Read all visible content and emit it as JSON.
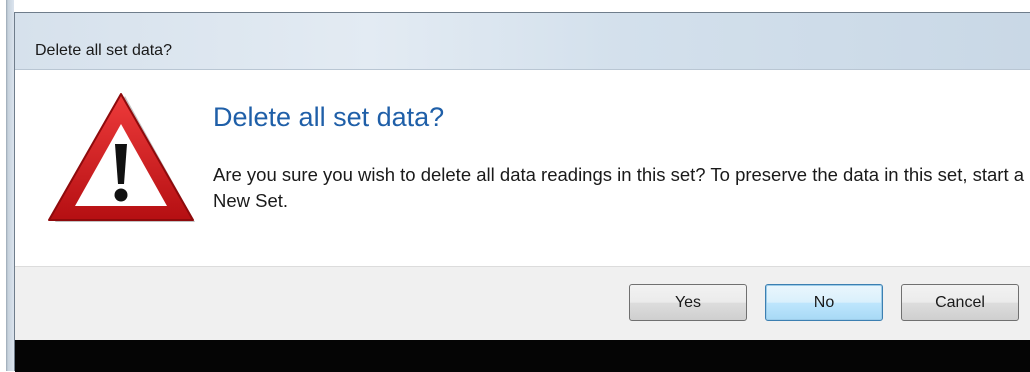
{
  "dialog": {
    "title": "Delete all set data?",
    "main_instruction": "Delete all set data?",
    "body": "Are you sure you wish to delete all data readings in this set? To preserve the data in this set, start a New Set.",
    "icon": "warning-icon",
    "buttons": {
      "yes": "Yes",
      "no": "No",
      "cancel": "Cancel",
      "default": "no"
    }
  },
  "colors": {
    "main_instruction": "#1f5fa8",
    "warning_red": "#d4191c",
    "default_button_border": "#3c7fb1"
  }
}
